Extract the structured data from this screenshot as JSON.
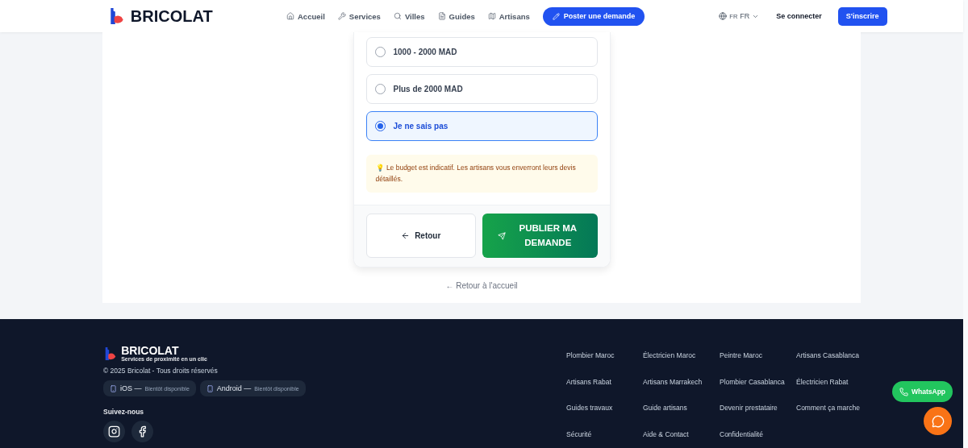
{
  "header": {
    "brand": "BRICOLAT",
    "nav": [
      {
        "label": "Accueil"
      },
      {
        "label": "Services"
      },
      {
        "label": "Villes"
      },
      {
        "label": "Guides"
      },
      {
        "label": "Artisans"
      }
    ],
    "post_button": "Poster une demande",
    "language": {
      "code": "FR",
      "label": "FR"
    },
    "login": "Se connecter",
    "signup": "S'inscrire"
  },
  "budget_options": [
    {
      "label": "1000 - 2000 MAD",
      "selected": false
    },
    {
      "label": "Plus de 2000 MAD",
      "selected": false
    },
    {
      "label": "Je ne sais pas",
      "selected": true
    }
  ],
  "tip": {
    "icon": "💡",
    "text": "Le budget est indicatif. Les artisans vous enverront leurs devis détaillés."
  },
  "back_button": "Retour",
  "publish_button": "PUBLIER MA DEMANDE",
  "home_link": "← Retour à l'accueil",
  "footer": {
    "brand": "BRICOLAT",
    "tagline": "Services de proximité en un clic",
    "copyright": "© 2025 Bricolat - Tous droits réservés",
    "apps": [
      {
        "name": "iOS —",
        "status": "Bientôt disponible"
      },
      {
        "name": "Android —",
        "status": "Bientôt disponible"
      }
    ],
    "follow_title": "Suivez-nous",
    "socials": [
      {
        "kind": "instagram"
      },
      {
        "kind": "facebook"
      }
    ],
    "links": [
      "Plombier Maroc",
      "Électricien Maroc",
      "Peintre Maroc",
      "Artisans Casablanca",
      "Artisans Rabat",
      "Artisans Marrakech",
      "Plombier Casablanca",
      "Électricien Rabat",
      "Guides travaux",
      "Guide artisans",
      "Devenir prestataire",
      "Comment ça marche",
      "Sécurité",
      "Aide & Contact",
      "Confidentialité"
    ]
  },
  "whatsapp_button": "WhatsApp"
}
